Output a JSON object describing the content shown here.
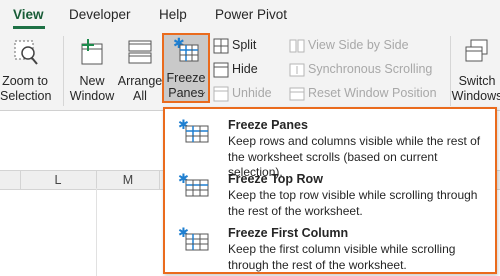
{
  "tabs": [
    {
      "label": "View",
      "active": true
    },
    {
      "label": "Developer",
      "active": false
    },
    {
      "label": "Help",
      "active": false
    },
    {
      "label": "Power Pivot",
      "active": false
    }
  ],
  "ribbon": {
    "zoom_to_selection": "Zoom to\nSelection",
    "new_window": "New\nWindow",
    "arrange_all": "Arrange\nAll",
    "freeze_panes": "Freeze\nPanes",
    "split": "Split",
    "hide": "Hide",
    "unhide": "Unhide",
    "view_side_by_side": "View Side by Side",
    "sync_scrolling": "Synchronous Scrolling",
    "reset_window_position": "Reset Window Position",
    "switch_windows": "Switch\nWindows"
  },
  "columns": [
    "L",
    "M"
  ],
  "freeze_menu": {
    "items": [
      {
        "title": "Freeze Panes",
        "desc": "Keep rows and columns visible while the rest of the worksheet scrolls (based on current selection)."
      },
      {
        "title": "Freeze Top Row",
        "desc": "Keep the top row visible while scrolling through the rest of the worksheet."
      },
      {
        "title": "Freeze First Column",
        "desc": "Keep the first column visible while scrolling through the rest of the worksheet."
      }
    ]
  },
  "colors": {
    "accent_green": "#185c37",
    "highlight_orange": "#ea6b1d",
    "icon_blue": "#1f7fd0"
  }
}
